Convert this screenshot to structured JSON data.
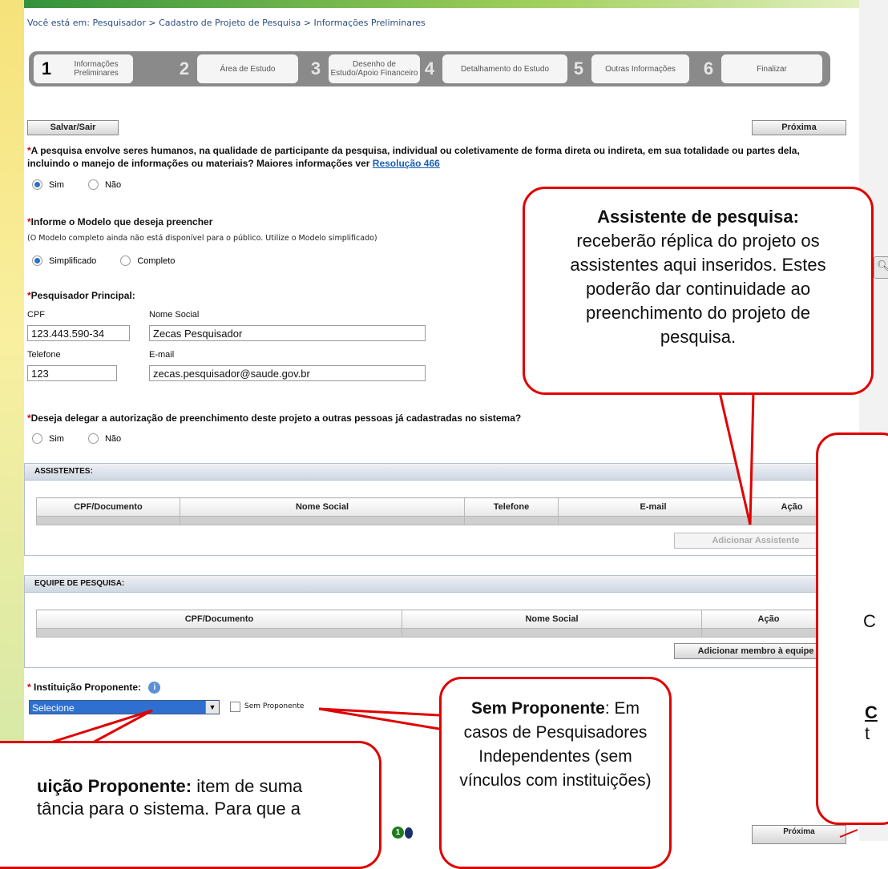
{
  "breadcrumb": "Você está em: Pesquisador > Cadastro de Projeto de Pesquisa > Informações Preliminares",
  "steps": [
    {
      "num": "1",
      "label": "Informações\nPreliminares"
    },
    {
      "num": "2",
      "label": "Área de Estudo"
    },
    {
      "num": "3",
      "label": "Desenho de\nEstudo/Apoio Financeiro"
    },
    {
      "num": "4",
      "label": "Detalhamento do Estudo"
    },
    {
      "num": "5",
      "label": "Outras Informações"
    },
    {
      "num": "6",
      "label": "Finalizar"
    }
  ],
  "toolbar": {
    "save_exit": "Salvar/Sair",
    "next": "Próxima"
  },
  "q1": {
    "text": "A pesquisa envolve seres humanos, na qualidade de participante da pesquisa, individual ou coletivamente de forma direta ou indireta, em sua totalidade ou partes dela, incluindo o manejo de informações ou materiais? Maiores informações ver ",
    "link": "Resolução 466",
    "opt_yes": "Sim",
    "opt_no": "Não"
  },
  "q2": {
    "text": "Informe o Modelo que deseja preencher",
    "hint": "(O Modelo completo ainda não está disponível para o público. Utilize o Modelo simplificado)",
    "opt_simple": "Simplificado",
    "opt_full": "Completo"
  },
  "researcher": {
    "title": "Pesquisador Principal:",
    "cpf_label": "CPF",
    "cpf": "123.443.590-34",
    "name_label": "Nome Social",
    "name": "Zecas Pesquisador",
    "phone_label": "Telefone",
    "phone": "123",
    "email_label": "E-mail",
    "email": "zecas.pesquisador@saude.gov.br"
  },
  "q3": {
    "text": "Deseja delegar a autorização de preenchimento deste projeto a outras pessoas já cadastradas no sistema?",
    "opt_yes": "Sim",
    "opt_no": "Não"
  },
  "assistants": {
    "title": "ASSISTENTES:",
    "cols": [
      "CPF/Documento",
      "Nome Social",
      "Telefone",
      "E-mail",
      "Ação"
    ],
    "add": "Adicionar Assistente"
  },
  "team": {
    "title": "EQUIPE DE PESQUISA:",
    "cols": [
      "CPF/Documento",
      "Nome Social",
      "Ação"
    ],
    "add": "Adicionar membro à equipe"
  },
  "institution": {
    "label": "Instituição Proponente:",
    "select": "Selecione",
    "no_proponent": "Sem Proponente"
  },
  "callouts": {
    "assistant_title": "Assistente de pesquisa:",
    "assistant_body": "receberão réplica do projeto os assistentes aqui inseridos. Estes poderão dar continuidade ao preenchimento do projeto de pesquisa.",
    "noprop_title": "Sem Proponente",
    "noprop_body": ": Em casos de Pesquisadores Independentes (sem vínculos com instituições)",
    "inst_title": "uição Proponente:",
    "inst_body_1": " item de suma",
    "inst_body_2": "tância para o sistema. Para que a",
    "right_c": "C",
    "right_t": "t"
  },
  "colors": {
    "accent_red": "#e00000",
    "link": "#1a5fb4",
    "select_blue": "#2f6fd0"
  }
}
